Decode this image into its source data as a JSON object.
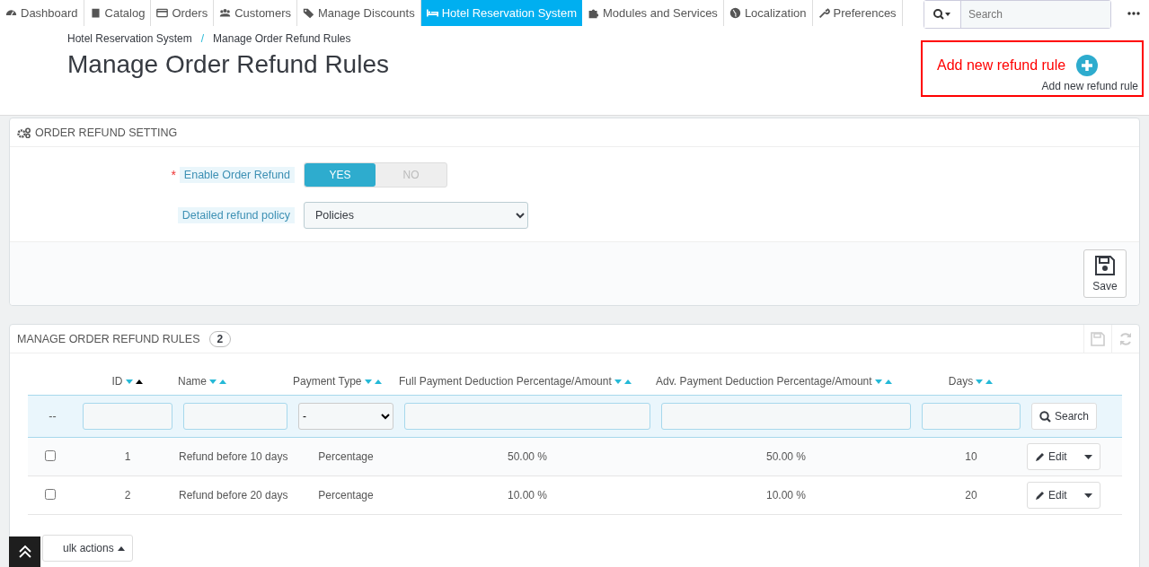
{
  "nav": [
    {
      "label": "Dashboard",
      "selected": false
    },
    {
      "label": "Catalog",
      "selected": false
    },
    {
      "label": "Orders",
      "selected": false
    },
    {
      "label": "Customers",
      "selected": false
    },
    {
      "label": "Manage Discounts",
      "selected": false
    },
    {
      "label": "Hotel Reservation System",
      "selected": true
    },
    {
      "label": "Modules and Services",
      "selected": false
    },
    {
      "label": "Localization",
      "selected": false
    },
    {
      "label": "Preferences",
      "selected": false
    }
  ],
  "search": {
    "placeholder": "Search"
  },
  "breadcrumb": [
    "Hotel Reservation System",
    "Manage Order Refund Rules"
  ],
  "breadcrumb_separator": "/",
  "page_title": "Manage Order Refund Rules",
  "add_rule": {
    "label": "Add new refund rule",
    "caption": "Add new refund rule"
  },
  "settings_panel": {
    "title": "ORDER REFUND SETTING",
    "enable_field": {
      "label": "Enable Order Refund",
      "required_mark": "*",
      "options": [
        {
          "label": "YES",
          "selected": true
        },
        {
          "label": "NO",
          "selected": false
        }
      ]
    },
    "policy_field": {
      "label": "Detailed refund policy",
      "value": "Policies"
    },
    "save_button": "Save"
  },
  "rules_panel": {
    "title": "MANAGE ORDER REFUND RULES",
    "count": "2",
    "columns": [
      {
        "label": "ID",
        "asc_active": true
      },
      {
        "label": "Name",
        "asc_active": false
      },
      {
        "label": "Payment Type",
        "asc_active": false
      },
      {
        "label": "Full Payment Deduction Percentage/Amount",
        "asc_active": false
      },
      {
        "label": "Adv. Payment Deduction Percentage/Amount",
        "asc_active": false
      },
      {
        "label": "Days",
        "asc_active": false
      }
    ],
    "filter": {
      "marker": "--",
      "payment_type": "-",
      "search_button": "Search"
    },
    "rows": [
      {
        "checked": false,
        "id": "1",
        "name": "Refund before 10 days",
        "payment_type": "Percentage",
        "full": "50.00 %",
        "adv": "50.00 %",
        "days": "10",
        "action": "Edit"
      },
      {
        "checked": false,
        "id": "2",
        "name": "Refund before 20 days",
        "payment_type": "Percentage",
        "full": "10.00 %",
        "adv": "10.00 %",
        "days": "20",
        "action": "Edit"
      }
    ],
    "bulk_actions": "ulk actions"
  }
}
